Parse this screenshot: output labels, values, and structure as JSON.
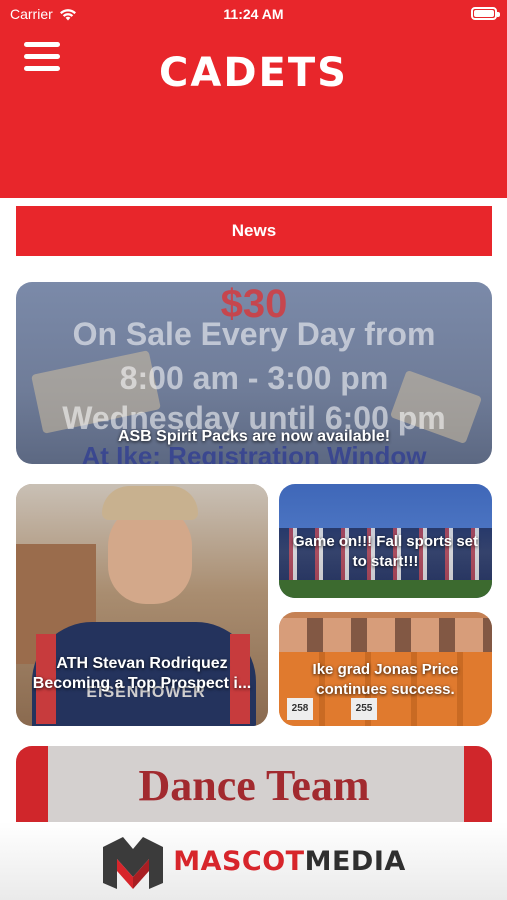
{
  "status_bar": {
    "carrier": "Carrier",
    "time": "11:24 AM"
  },
  "header": {
    "title": "CADETS",
    "menu_icon": "hamburger-menu-icon"
  },
  "news_tab": {
    "label": "News"
  },
  "cards": [
    {
      "caption": "ASB Spirit Packs are now available!",
      "image_text": {
        "price": "$30",
        "line1": "On Sale Every Day from",
        "line2": "8:00 am - 3:00 pm",
        "line3": "Wednesday until 6:00 pm",
        "line4": "At Ike: Registration Window"
      }
    },
    {
      "caption": "ATH Stevan Rodriquez Becoming a Top Prospect i...",
      "image_text": {
        "jersey": "EISENHOWER"
      }
    },
    {
      "caption": "Game on!!! Fall sports set to start!!!"
    },
    {
      "caption": "Ike grad Jonas Price continues success.",
      "image_text": {
        "bib1": "258",
        "bib2": "255"
      }
    },
    {
      "caption": "",
      "image_text": {
        "title": "Dance Team"
      }
    }
  ],
  "footer": {
    "brand_part1": "MASCOT",
    "brand_part2": "MEDIA",
    "logo_icon": "mascot-media-logo-icon"
  },
  "colors": {
    "primary": "#e8262b",
    "dark": "#2f2f2f"
  }
}
